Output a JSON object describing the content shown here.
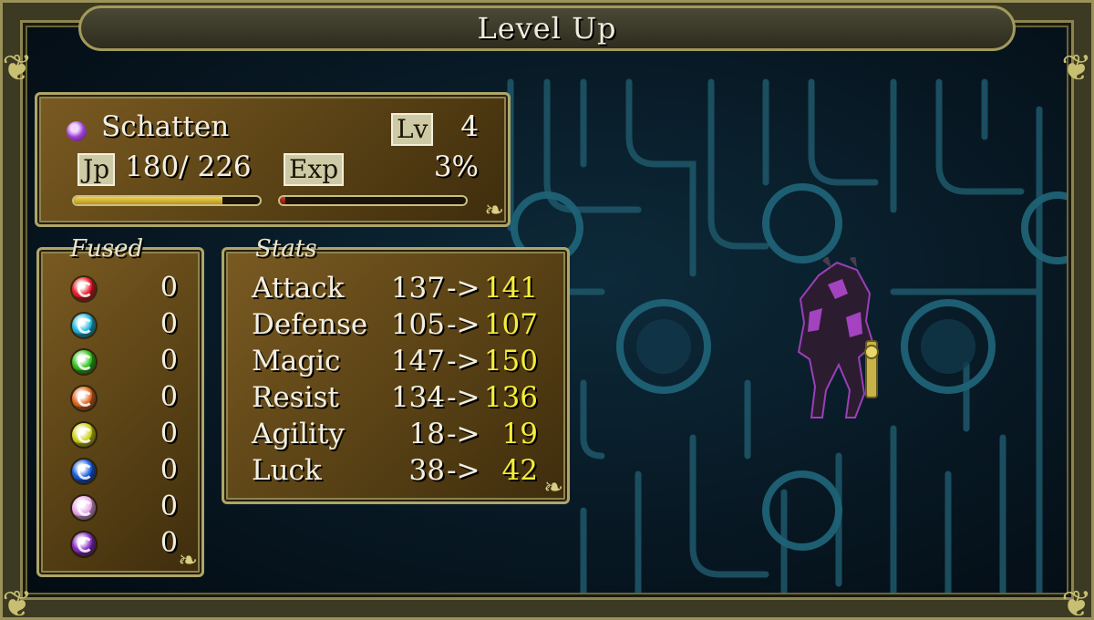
{
  "title": "Level Up",
  "character": {
    "name": "Schatten",
    "orb_color": "#9b3fd0",
    "lv_label": "Lv",
    "level": "4",
    "jp_label": "Jp",
    "jp_value": "180/ 226",
    "jp_progress": 0.797,
    "exp_label": "Exp",
    "exp_value": "3%",
    "exp_progress": 0.03
  },
  "fused": {
    "label": "Fused",
    "items": [
      {
        "gem": "red-gem-icon",
        "color": "#e8202a",
        "count": "0"
      },
      {
        "gem": "cyan-gem-icon",
        "color": "#22b8e0",
        "count": "0"
      },
      {
        "gem": "green-gem-icon",
        "color": "#32c21e",
        "count": "0"
      },
      {
        "gem": "orange-gem-icon",
        "color": "#e06a24",
        "count": "0"
      },
      {
        "gem": "yellow-gem-icon",
        "color": "#cfd21c",
        "count": "0"
      },
      {
        "gem": "blue-gem-icon",
        "color": "#1a5ee0",
        "count": "0"
      },
      {
        "gem": "pink-gem-icon",
        "color": "#e9a8e8",
        "count": "0"
      },
      {
        "gem": "purple-gem-icon",
        "color": "#8a2fc4",
        "count": "0"
      }
    ]
  },
  "stats": {
    "label": "Stats",
    "rows": [
      {
        "name": "Attack",
        "old": "137",
        "arrow": "->",
        "new": "141"
      },
      {
        "name": "Defense",
        "old": "105",
        "arrow": "->",
        "new": "107"
      },
      {
        "name": "Magic",
        "old": "147",
        "arrow": "->",
        "new": "150"
      },
      {
        "name": "Resist",
        "old": "134",
        "arrow": "->",
        "new": "136"
      },
      {
        "name": "Agility",
        "old": "18",
        "arrow": "->",
        "new": "19"
      },
      {
        "name": "Luck",
        "old": "38",
        "arrow": "->",
        "new": "42"
      }
    ]
  },
  "colors": {
    "panel_border": "#aea56a",
    "new_stat": "#f4ee3a",
    "jp_bar": "#e2c13a",
    "exp_bar": "#c02a20",
    "circuit": "#1e5a6c"
  }
}
